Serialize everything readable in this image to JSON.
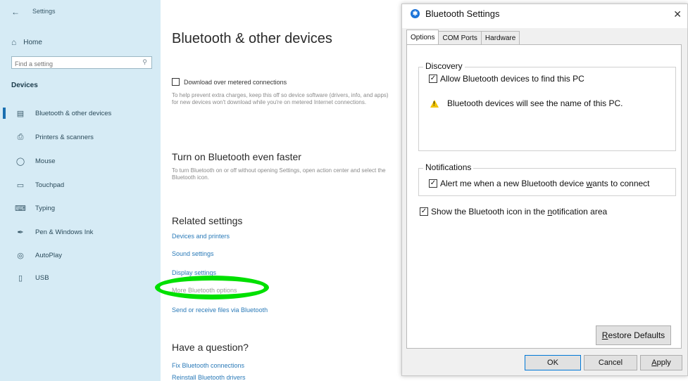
{
  "settings": {
    "title": "Settings",
    "home_label": "Home",
    "search_placeholder": "Find a setting",
    "section": "Devices",
    "nav": [
      {
        "label": "Bluetooth & other devices",
        "icon": "bluetooth-devices-icon",
        "active": true
      },
      {
        "label": "Printers & scanners",
        "icon": "printer-icon",
        "active": false
      },
      {
        "label": "Mouse",
        "icon": "mouse-icon",
        "active": false
      },
      {
        "label": "Touchpad",
        "icon": "touchpad-icon",
        "active": false
      },
      {
        "label": "Typing",
        "icon": "keyboard-icon",
        "active": false
      },
      {
        "label": "Pen & Windows Ink",
        "icon": "pen-icon",
        "active": false
      },
      {
        "label": "AutoPlay",
        "icon": "autoplay-icon",
        "active": false
      },
      {
        "label": "USB",
        "icon": "usb-icon",
        "active": false
      }
    ],
    "main": {
      "title": "Bluetooth & other devices",
      "download_label": "Download over metered connections",
      "download_desc": "To help prevent extra charges, keep this off so device software (drivers, info, and apps) for new devices won't download while you're on metered Internet connections.",
      "faster_heading": "Turn on Bluetooth even faster",
      "faster_desc": "To turn Bluetooth on or off without opening Settings, open action center and select the Bluetooth icon.",
      "related_heading": "Related settings",
      "related_links": [
        "Devices and printers",
        "Sound settings",
        "Display settings",
        "More Bluetooth options",
        "Send or receive files via Bluetooth"
      ],
      "question_heading": "Have a question?",
      "question_links": [
        "Fix Bluetooth connections",
        "Reinstall Bluetooth drivers"
      ]
    }
  },
  "dialog": {
    "title": "Bluetooth Settings",
    "tabs": [
      "Options",
      "COM Ports",
      "Hardware"
    ],
    "discovery_legend": "Discovery",
    "allow_label": "Allow Bluetooth devices to find this PC",
    "allow_checked": true,
    "warning_text": "Bluetooth devices will see the name of this PC.",
    "notifications_legend": "Notifications",
    "alert_pre": "Alert me when a new Bluetooth device ",
    "alert_accel": "w",
    "alert_post": "ants to connect",
    "alert_checked": true,
    "show_pre": "Show the Bluetooth icon in the ",
    "show_accel": "n",
    "show_post": "otification area",
    "show_checked": true,
    "restore_pre": "",
    "restore_accel": "R",
    "restore_post": "estore Defaults",
    "ok_label": "OK",
    "cancel_label": "Cancel",
    "apply_accel": "A",
    "apply_post": "pply",
    "check_mark": "✓"
  },
  "colors": {
    "sidebar_bg": "#d6ebf5",
    "link": "#2a7ab8",
    "highlight": "#00e000",
    "bluetooth_blue": "#1b73d8"
  }
}
